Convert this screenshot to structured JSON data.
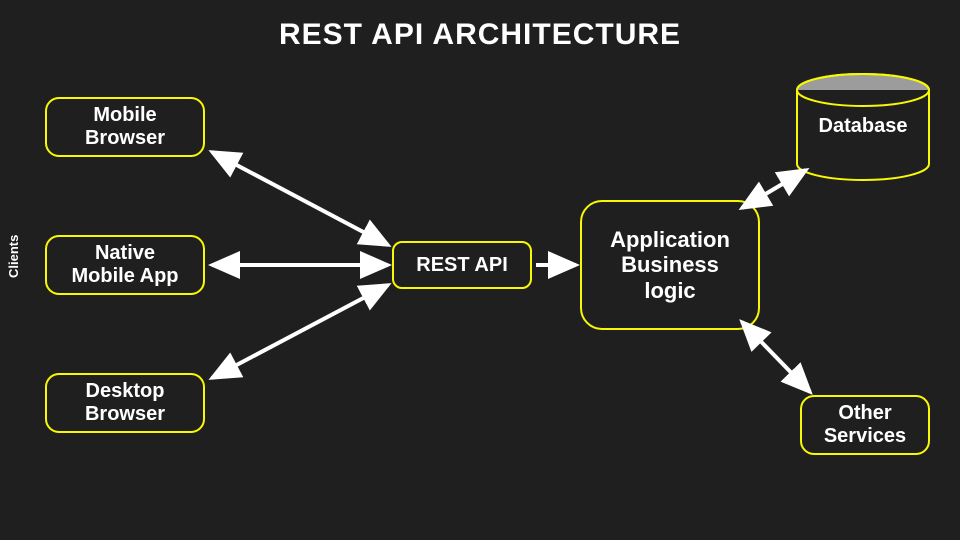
{
  "title": "REST API ARCHITECTURE",
  "clients_label": "Clients",
  "nodes": {
    "mobile_browser": "Mobile\nBrowser",
    "native_app": "Native\nMobile App",
    "desktop_browser": "Desktop\nBrowser",
    "rest_api": "REST API",
    "app_logic": "Application\nBusiness\nlogic",
    "database": "Database",
    "other_services": "Other\nServices"
  },
  "colors": {
    "bg": "#1f1f1f",
    "border": "#f8f806",
    "text": "#ffffff",
    "arrow": "#ffffff",
    "db_top": "#9c9c9c"
  }
}
